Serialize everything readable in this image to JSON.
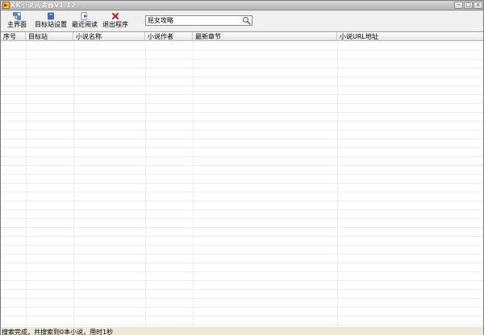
{
  "window": {
    "title": "KK小说阅读器V1.12",
    "minimize_glyph": "−",
    "maximize_glyph": "□",
    "close_glyph": "×"
  },
  "toolbar": {
    "items": [
      {
        "label": "主界面",
        "icon": "home-icon"
      },
      {
        "label": "目标站设置",
        "icon": "settings-icon"
      },
      {
        "label": "最近阅读",
        "icon": "recent-read-icon"
      },
      {
        "label": "退出程序",
        "icon": "exit-icon"
      }
    ]
  },
  "search": {
    "value": "屈女攻略",
    "placeholder": ""
  },
  "table": {
    "columns": [
      "序号",
      "目标站",
      "小说名称",
      "小说作者",
      "最新章节",
      "小说URL地址"
    ],
    "rows": []
  },
  "status": {
    "text": "搜索完成，共搜索到0本小说，用时1秒"
  },
  "colors": {
    "grid_line": "#ececec",
    "exit_red": "#cc1a1a",
    "settings_blue": "#3a6fc9"
  }
}
